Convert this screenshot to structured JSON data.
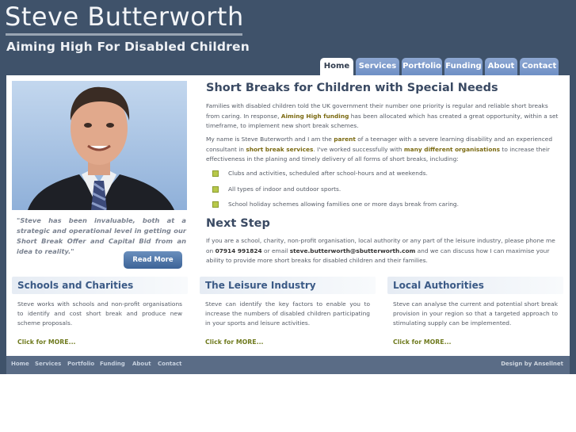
{
  "header": {
    "title": "Steve Butterworth",
    "tagline": "Aiming High For Disabled Children"
  },
  "nav": {
    "tabs": [
      "Home",
      "Services",
      "Portfolio",
      "Funding",
      "About",
      "Contact"
    ],
    "active": "Home"
  },
  "sidebar": {
    "quote": "\"Steve has been invaluable, both at a strategic and operational level in getting our Short Break Offer and Capital Bid from an idea to reality.\"",
    "read_more": "Read More"
  },
  "main": {
    "title": "Short Breaks for Children with Special Needs",
    "p1_a": "Families with disabled children told the UK government their number one priority is regular and reliable short breaks from caring. In response, ",
    "p1_hl": "Aiming High funding",
    "p1_b": " has been allocated which has created a great opportunity, within a set timeframe, to implement new short break schemes.",
    "p2_a": "My name is Steve Buterworth and I am the ",
    "p2_hl1": "parent",
    "p2_b": " of a teenager with a severe learning disability and an experienced consultant in ",
    "p2_hl2": "short break services",
    "p2_c": ". I've worked successfully with ",
    "p2_hl3": "many different organisations",
    "p2_d": " to increase their effectiveness in the planing and timely delivery of all forms of short breaks, including:",
    "bullets": [
      "Clubs and activities, scheduled after school-hours and at weekends.",
      "All types of indoor and outdoor sports.",
      "School holiday schemes allowing families one or more days break from caring."
    ],
    "next_title": "Next Step",
    "next_a": "If you are a school, charity, non-profit organisation, local authority or any part of the leisure industry, please phone me on ",
    "next_phone": "07914 991824",
    "next_b": " or email ",
    "next_email": "steve.butterworth@sbutterworth.com",
    "next_c": " and we can discuss how I can maximise your ability to provide more short breaks for disabled children and their families."
  },
  "columns": [
    {
      "title": "Schools and Charities",
      "body": "Steve works with schools and non-profit organisations to identify and cost short break and produce new scheme proposals.",
      "more": "Click for MORE..."
    },
    {
      "title": "The Leisure Industry",
      "body": "Steve can identify the key factors to enable you to increase the numbers of disabled children participating in your sports and leisure activities.",
      "more": "Click for MORE..."
    },
    {
      "title": "Local Authorities",
      "body": "Steve can analyse the current and potential short break provision in your region so that a targeted approach to stimulating supply can be implemented.",
      "more": "Click for MORE..."
    }
  ],
  "footer": {
    "links": [
      "Home",
      "Services",
      "Portfolio",
      "Funding",
      "About",
      "Contact"
    ],
    "credit": "Design by Ansellnet"
  }
}
